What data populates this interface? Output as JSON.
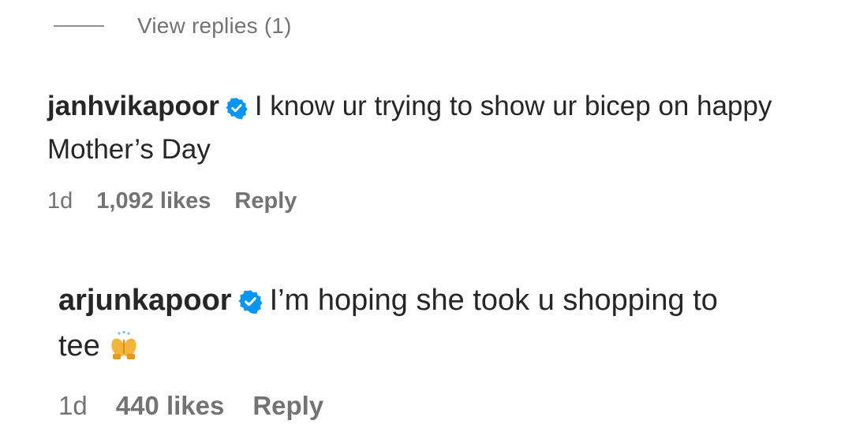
{
  "thread": {
    "view_replies_label": "View replies (1)"
  },
  "comments": [
    {
      "username": "janhvikapoor",
      "verified": true,
      "text_line1": "I know ur trying to show ur bicep on happy",
      "text_line2": "Mother’s Day",
      "age": "1d",
      "likes": "1,092 likes",
      "reply_label": "Reply"
    },
    {
      "username": "arjunkapoor",
      "verified": true,
      "text_line1": "I’m hoping she took u shopping to",
      "text_line2": "tee",
      "emoji": "praying-hands-emoji",
      "age": "1d",
      "likes": "440 likes",
      "reply_label": "Reply"
    }
  ],
  "colors": {
    "text_primary": "#262626",
    "text_secondary": "#737373",
    "verified_badge": "#0095F6",
    "background": "#FFFFFF"
  }
}
